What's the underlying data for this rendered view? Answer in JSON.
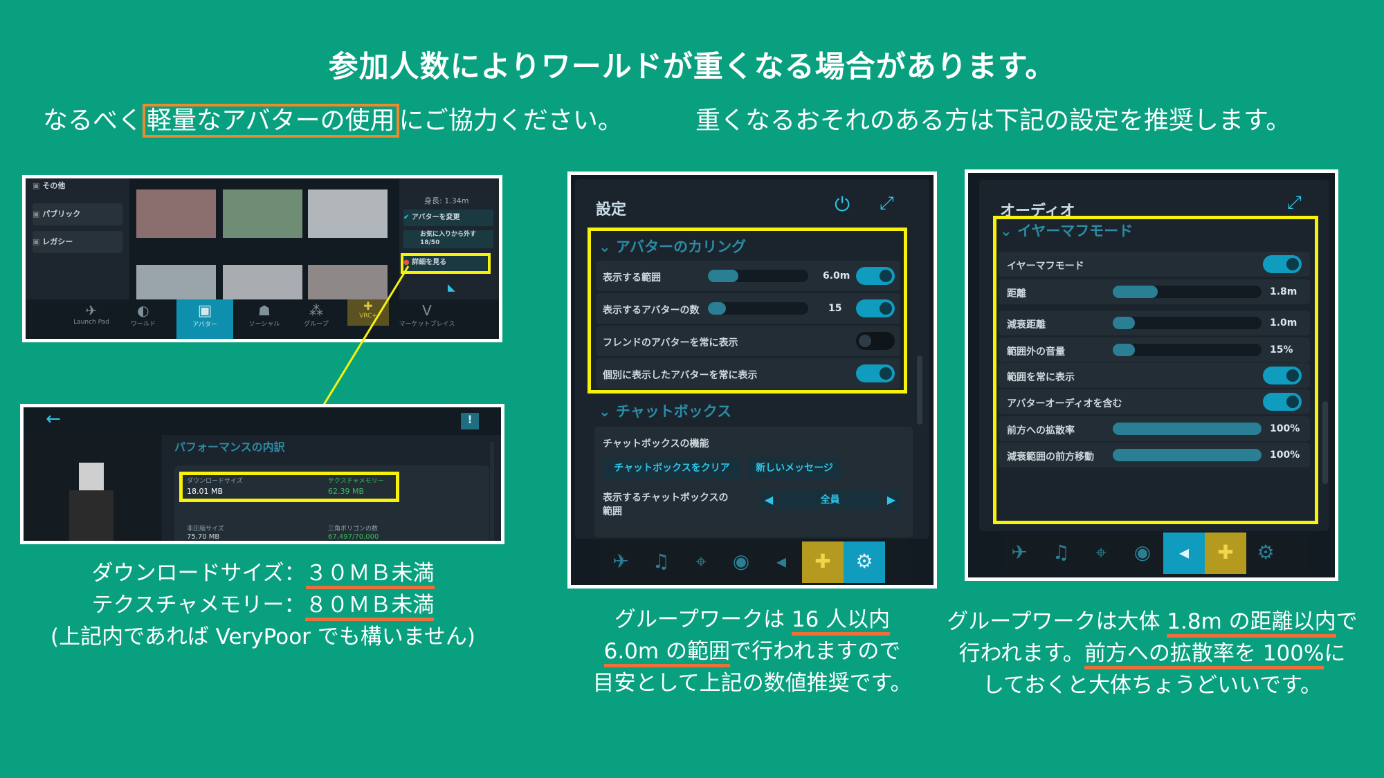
{
  "header": {
    "title": "参加人数によりワールドが重くなる場合があります。",
    "left_prefix": "なるべく",
    "left_highlight": "軽量なアバターの使用",
    "left_suffix": "にご協力ください。",
    "right_text": "重くなるおそれのある方は下記の設定を推奨します。"
  },
  "left_shot_top": {
    "sidebar": [
      "その他",
      "パブリック",
      "レガシー"
    ],
    "height_label": "身長: 1.34m",
    "menu": [
      "アバターを変更",
      "お気に入りから外す",
      "18/50",
      "詳細を見る"
    ],
    "dock": [
      "Launch Pad",
      "ワールド",
      "アバター",
      "ソーシャル",
      "グループ",
      "VRC+",
      "マーケットプレイス"
    ]
  },
  "left_shot_bottom": {
    "section_title": "パフォーマンスの内訳",
    "download_label": "ダウンロードサイズ",
    "download_value": "18.01 MB",
    "texture_label": "テクスチャメモリー",
    "texture_value": "62.39 MB",
    "uncompressed_label": "非圧縮サイズ",
    "uncompressed_value": "75.70 MB",
    "polygon_label": "三角ポリゴンの数",
    "polygon_value": "67,497/70,000"
  },
  "left_caption": {
    "line1_prefix": "ダウンロードサイズ：",
    "line1_value": "３０ＭＢ未満",
    "line2_prefix": "テクスチャメモリー：",
    "line2_value": "８０ＭＢ未満",
    "line3": "(上記内であれば VeryPoor でも構いません)"
  },
  "settings_panel": {
    "title": "設定",
    "culling_section": "アバターのカリング",
    "rows": [
      {
        "label": "表示する範囲",
        "value": "6.0m",
        "level": 0.3,
        "toggle": true
      },
      {
        "label": "表示するアバターの数",
        "value": "15",
        "level": 0.18,
        "toggle": true
      },
      {
        "label": "フレンドのアバターを常に表示",
        "toggle": false
      },
      {
        "label": "個別に表示したアバターを常に表示",
        "toggle": true
      }
    ],
    "chatbox_section": "チャットボックス",
    "chatbox_feature": "チャットボックスの機能",
    "clear_button": "チャットボックスをクリア",
    "new_message": "新しいメッセージ",
    "range_label": "表示するチャットボックスの",
    "range_label2": "範囲",
    "range_value": "全員"
  },
  "middle_caption": {
    "line1_prefix": "グループワークは ",
    "line1_value": "16 人以内",
    "line2_value": "6.0m の範囲",
    "line2_suffix": "で行われますので",
    "line3": "目安として上記の数値推奨です。"
  },
  "audio_panel": {
    "title": "オーディオ",
    "section": "イヤーマフモード",
    "rows": [
      {
        "label": "イヤーマフモード",
        "toggle": true
      },
      {
        "label": "距離",
        "value": "1.8m",
        "level": 0.3
      },
      {
        "label": "減衰距離",
        "value": "1.0m",
        "level": 0.15
      },
      {
        "label": "範囲外の音量",
        "value": "15%",
        "level": 0.15
      },
      {
        "label": "範囲を常に表示",
        "toggle": true
      },
      {
        "label": "アバターオーディオを含む",
        "toggle": true
      },
      {
        "label": "前方への拡散率",
        "value": "100%",
        "level": 1.0
      },
      {
        "label": "減衰範囲の前方移動",
        "value": "100%",
        "level": 1.0
      }
    ]
  },
  "right_caption": {
    "line1_prefix": "グループワークは大体 ",
    "line1_value": "1.8m の距離以内",
    "line1_suffix": "で",
    "line2_prefix": "行われます。",
    "line2_value": "前方への拡散率を 100%",
    "line2_suffix": "に",
    "line3": "しておくと大体ちょうどいいです。"
  },
  "colors": {
    "background": "#08a07f",
    "highlight": "#f7f20c",
    "underline": "#ee6f3a",
    "accent": "#0f9cbf"
  }
}
